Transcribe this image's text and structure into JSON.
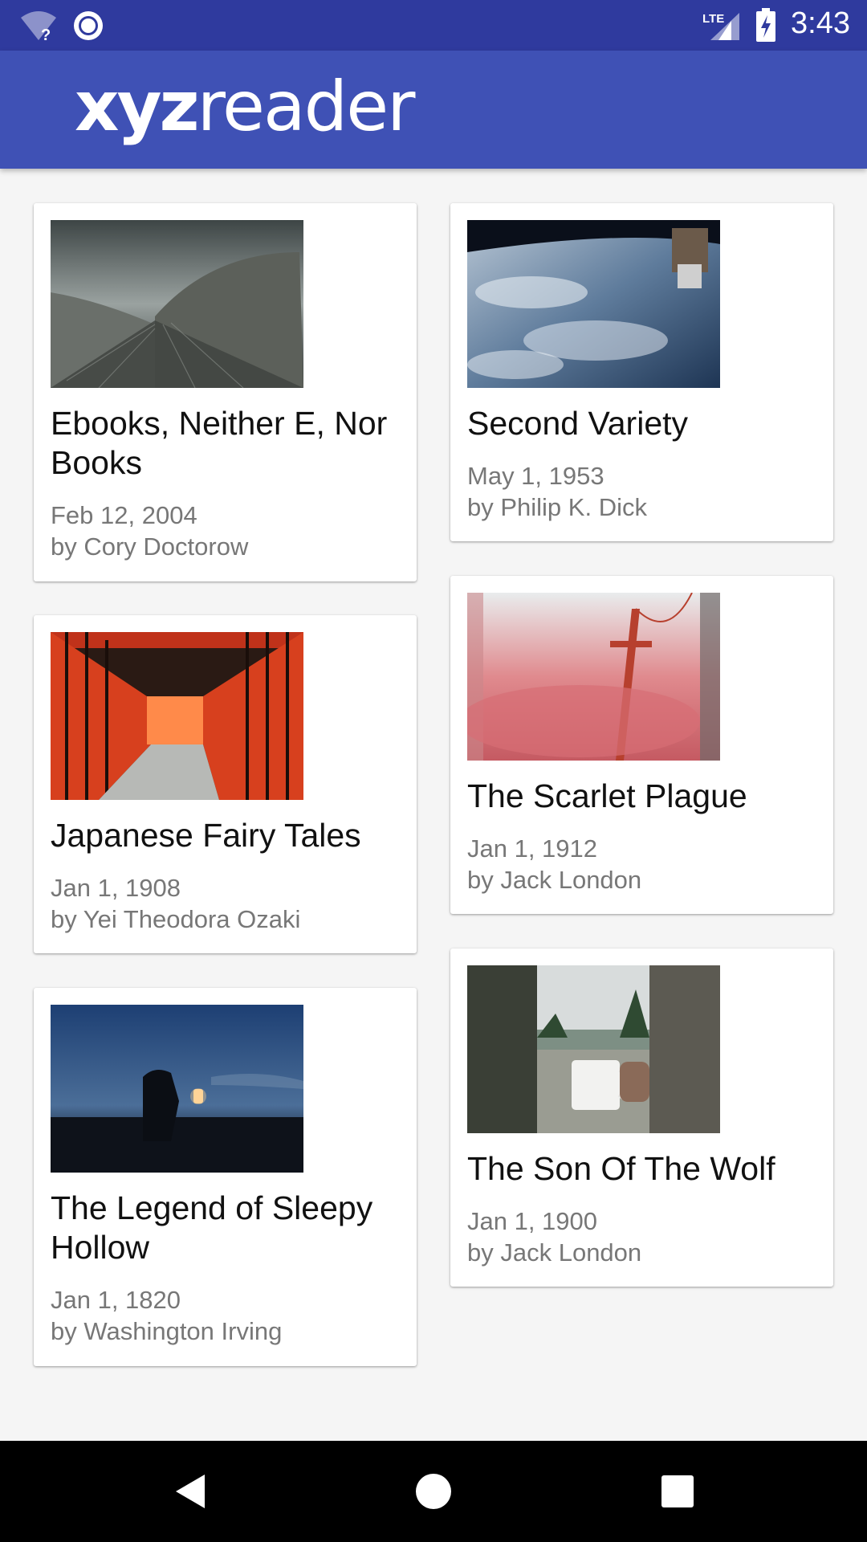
{
  "status_bar": {
    "time": "3:43",
    "network": "LTE",
    "icons": [
      "wifi-unknown-icon",
      "sync-icon",
      "signal-icon",
      "battery-charging-icon"
    ]
  },
  "app_bar": {
    "logo_bold": "xyz",
    "logo_light": "reader"
  },
  "articles": [
    {
      "title": "Ebooks, Neither E, Nor Books",
      "date": "Feb 12, 2004",
      "author": "by Cory Doctorow",
      "image": "architecture-roof"
    },
    {
      "title": "Second Variety",
      "date": "May 1, 1953",
      "author": "by Philip K. Dick",
      "image": "earth-from-space"
    },
    {
      "title": "Japanese Fairy Tales",
      "date": "Jan 1, 1908",
      "author": "by Yei Theodora Ozaki",
      "image": "torii-gates"
    },
    {
      "title": "The Scarlet Plague",
      "date": "Jan 1, 1912",
      "author": "by Jack London",
      "image": "bridge-in-red-fog"
    },
    {
      "title": "The Legend of Sleepy Hollow",
      "date": "Jan 1, 1820",
      "author": "by Washington Irving",
      "image": "lantern-at-dusk"
    },
    {
      "title": "The Son Of The Wolf",
      "date": "Jan 1, 1900",
      "author": "by Jack London",
      "image": "adventure-mug-lake"
    }
  ],
  "nav_bar": {
    "buttons": [
      "back-icon",
      "home-icon",
      "recents-icon"
    ]
  },
  "colors": {
    "status_bar": "#2f3a9e",
    "primary": "#3f51b5",
    "background": "#f5f5f5",
    "meta_text": "#777777"
  }
}
